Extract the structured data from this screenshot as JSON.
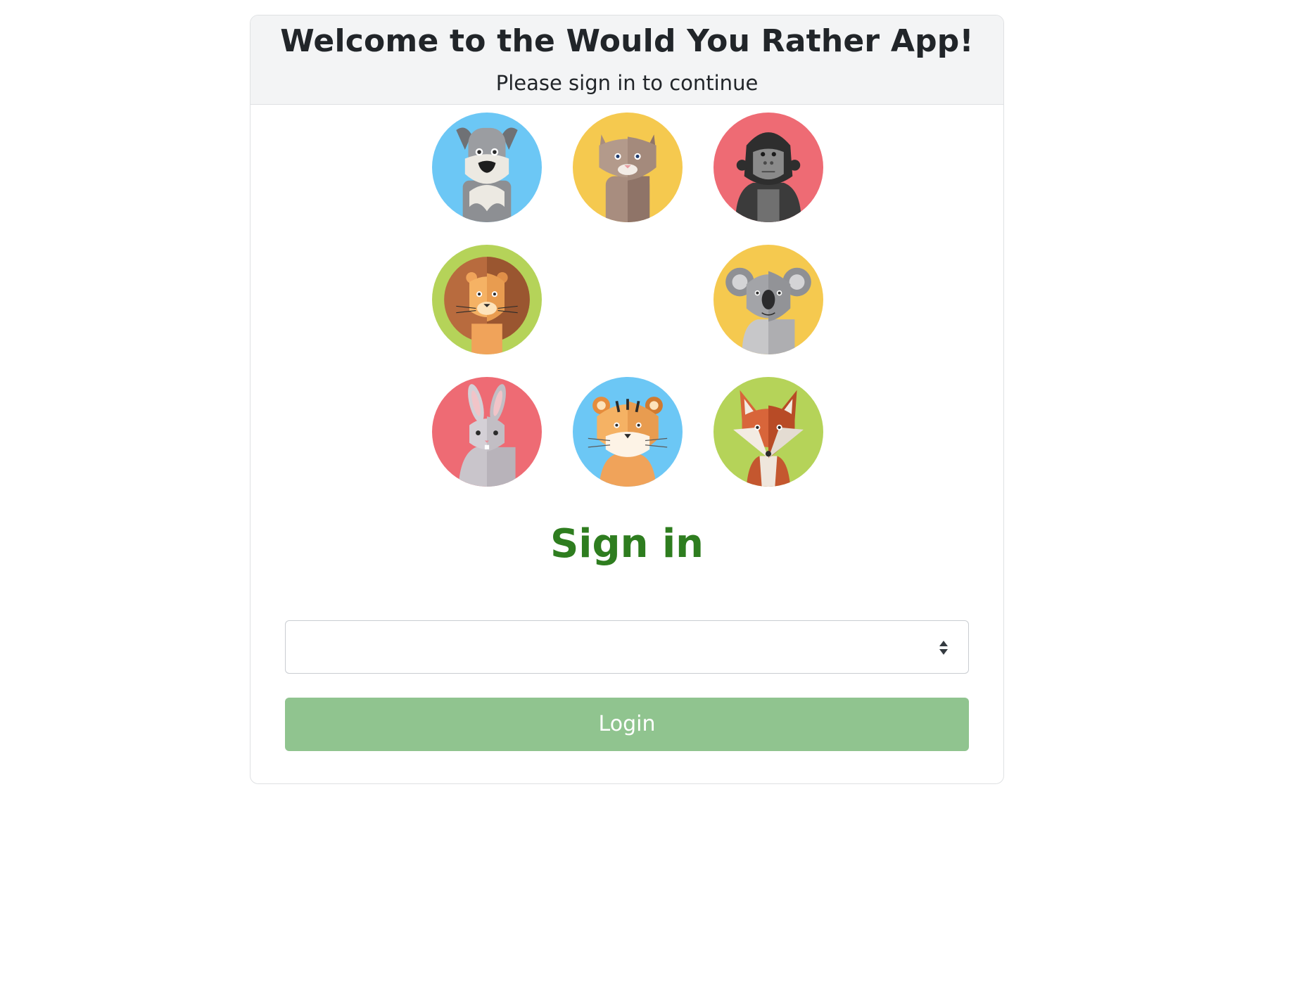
{
  "header": {
    "title": "Welcome to the Would You Rather App!",
    "subtitle": "Please sign in to continue"
  },
  "avatars": [
    {
      "icon": "schnauzer-dog-icon",
      "background": "#6cc7f5"
    },
    {
      "icon": "cat-icon",
      "background": "#f5c94f"
    },
    {
      "icon": "gorilla-icon",
      "background": "#ee6b74"
    },
    {
      "icon": "lion-icon",
      "background": "#b5d359"
    },
    {
      "icon": "koala-icon",
      "background": "#f5c94f"
    },
    {
      "icon": "rabbit-icon",
      "background": "#ee6b74"
    },
    {
      "icon": "tiger-icon",
      "background": "#6cc7f5"
    },
    {
      "icon": "fox-icon",
      "background": "#b5d359"
    }
  ],
  "sign_in": {
    "title": "Sign in",
    "title_color": "#2e7d1f"
  },
  "user_select": {
    "value": "",
    "arrow_icon": "up-down-arrows-icon"
  },
  "login": {
    "label": "Login",
    "color": "#90c48f"
  }
}
